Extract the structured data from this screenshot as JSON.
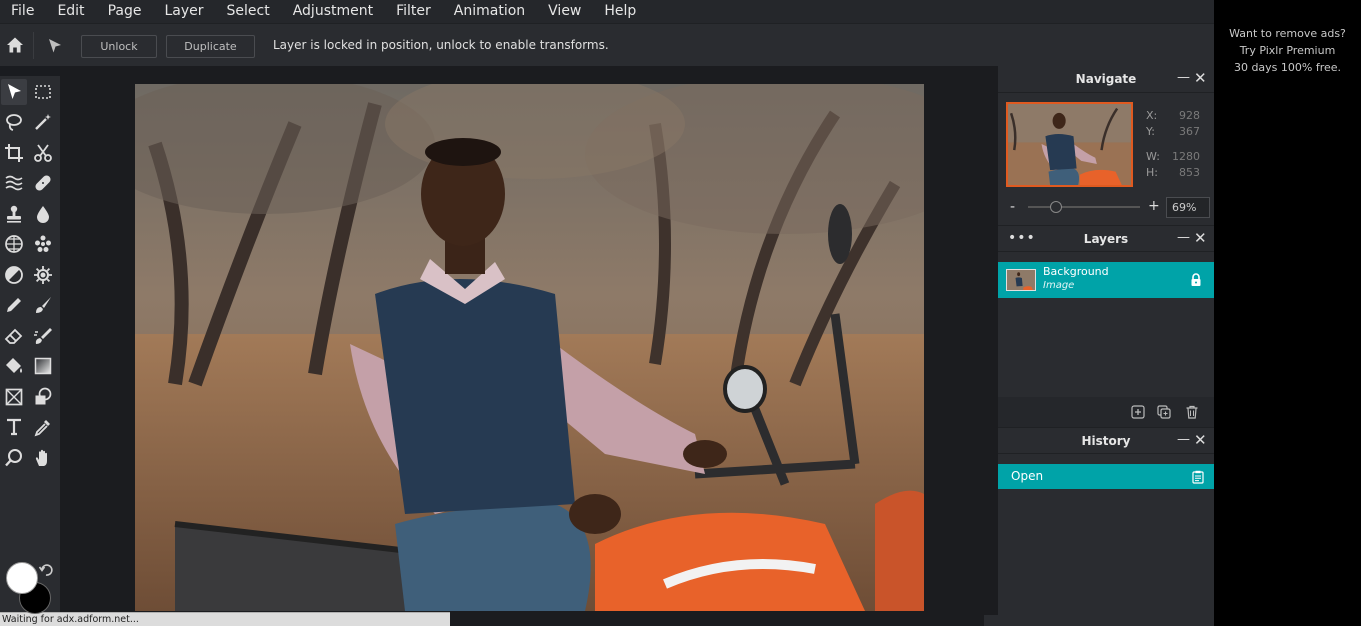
{
  "menu": [
    "File",
    "Edit",
    "Page",
    "Layer",
    "Select",
    "Adjustment",
    "Filter",
    "Animation",
    "View",
    "Help"
  ],
  "options": {
    "unlock_label": "Unlock",
    "duplicate_label": "Duplicate",
    "message": "Layer is locked in position, unlock to enable transforms."
  },
  "tools": [
    "arrange-tool",
    "marquee-select-tool",
    "lasso-select-tool",
    "magic-wand-tool",
    "crop-tool",
    "cutout-tool",
    "liquify-tool",
    "heal-tool",
    "clone-stamp-tool",
    "blur-tool",
    "sponge-tool",
    "spot-heal-tool",
    "dodge-burn-tool",
    "detail-tool",
    "pen-tool",
    "brush-tool",
    "eraser-tool",
    "smudge-brush-tool",
    "fill-tool",
    "gradient-tool",
    "frame-tool",
    "shape-tool",
    "text-tool",
    "color-picker-tool",
    "zoom-tool",
    "hand-tool"
  ],
  "colors": {
    "foreground": "#ffffff",
    "background": "#000000",
    "accent": "#00a3a8"
  },
  "navigate": {
    "title": "Navigate",
    "x_label": "X:",
    "x_value": "928",
    "y_label": "Y:",
    "y_value": "367",
    "w_label": "W:",
    "w_value": "1280",
    "h_label": "H:",
    "h_value": "853",
    "zoom_minus": "-",
    "zoom_plus": "+",
    "zoom": "69%",
    "zoom_slider_fraction": 0.25
  },
  "layers": {
    "title": "Layers",
    "items": [
      {
        "name": "Background",
        "type": "Image",
        "locked": true
      }
    ]
  },
  "history": {
    "title": "History",
    "items": [
      {
        "label": "Open"
      }
    ]
  },
  "ad": {
    "line1": "Want to remove ads?",
    "line2": "Try Pixlr Premium",
    "line3": "30 days 100% free."
  },
  "status": "Waiting for adx.adform.net..."
}
